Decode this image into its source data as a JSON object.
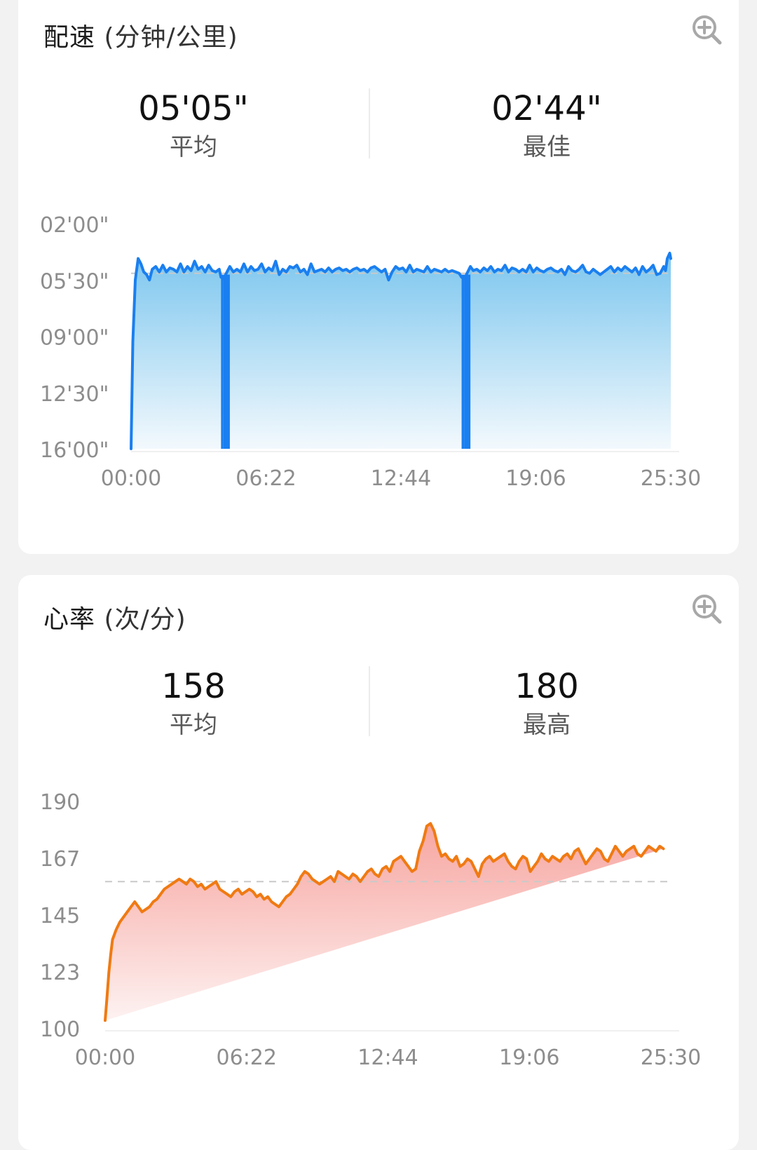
{
  "pace": {
    "title": "配速",
    "unit": "(分钟/公里)",
    "zoom_icon": "zoom-in-icon",
    "avg_value": "05'05\"",
    "avg_label": "平均",
    "best_value": "02'44\"",
    "best_label": "最佳",
    "colors": {
      "line": "#1a7ff0",
      "fill_top": "#7cc6ee",
      "fill_bottom": "#f3f9fd",
      "avg_line": "#c9c9c9"
    },
    "chart_data": {
      "type": "area",
      "title": "配速 (分钟/公里)",
      "xlabel": "",
      "ylabel": "",
      "x_ticks": [
        "00:00",
        "06:22",
        "12:44",
        "19:06",
        "25:30"
      ],
      "y_ticks": [
        "02'00\"",
        "05'30\"",
        "09'00\"",
        "12'30\"",
        "16'00\""
      ],
      "y_axis_inverted": true,
      "ylim_sec_per_km": [
        120,
        960
      ],
      "xlim_sec": [
        0,
        1530
      ],
      "average_sec_per_km": 305,
      "best_sec_per_km": 164,
      "grid": false,
      "series": [
        {
          "x_sec": [
            0,
            5,
            12,
            20,
            28,
            36,
            44,
            52,
            60,
            70,
            80,
            90,
            100,
            110,
            120,
            130,
            140,
            150,
            160,
            170,
            180,
            190,
            200,
            210,
            220,
            230,
            240,
            250,
            255,
            262,
            280,
            290,
            300,
            310,
            320,
            330,
            340,
            350,
            360,
            370,
            380,
            390,
            400,
            410,
            420,
            430,
            440,
            450,
            460,
            470,
            480,
            490,
            500,
            510,
            520,
            530,
            540,
            550,
            560,
            570,
            580,
            590,
            600,
            610,
            620,
            630,
            640,
            650,
            660,
            670,
            680,
            690,
            700,
            710,
            720,
            730,
            740,
            750,
            760,
            770,
            780,
            790,
            800,
            810,
            820,
            830,
            840,
            850,
            860,
            870,
            880,
            890,
            900,
            910,
            920,
            930,
            937,
            945,
            962,
            970,
            980,
            990,
            1000,
            1010,
            1020,
            1030,
            1040,
            1050,
            1060,
            1070,
            1080,
            1090,
            1100,
            1110,
            1120,
            1130,
            1140,
            1150,
            1160,
            1170,
            1180,
            1190,
            1200,
            1210,
            1220,
            1230,
            1240,
            1250,
            1260,
            1270,
            1280,
            1290,
            1300,
            1310,
            1320,
            1330,
            1340,
            1350,
            1360,
            1370,
            1380,
            1390,
            1400,
            1410,
            1420,
            1430,
            1440,
            1450,
            1460,
            1470,
            1480,
            1490,
            1500,
            1510,
            1515,
            1520,
            1527,
            1530
          ],
          "pace_sec_per_km": [
            960,
            560,
            330,
            250,
            270,
            300,
            310,
            330,
            290,
            280,
            300,
            275,
            300,
            285,
            290,
            300,
            270,
            300,
            280,
            295,
            260,
            290,
            280,
            300,
            275,
            295,
            300,
            290,
            320,
            325,
            280,
            300,
            290,
            300,
            270,
            300,
            280,
            295,
            290,
            270,
            300,
            285,
            295,
            260,
            310,
            290,
            300,
            280,
            285,
            275,
            300,
            290,
            310,
            270,
            300,
            295,
            290,
            300,
            285,
            300,
            290,
            285,
            295,
            290,
            300,
            290,
            285,
            295,
            290,
            300,
            285,
            280,
            290,
            300,
            290,
            330,
            300,
            280,
            290,
            285,
            300,
            275,
            300,
            290,
            295,
            300,
            280,
            300,
            290,
            295,
            300,
            290,
            300,
            295,
            300,
            305,
            320,
            325,
            280,
            295,
            290,
            300,
            285,
            295,
            280,
            300,
            290,
            295,
            275,
            300,
            285,
            290,
            300,
            290,
            300,
            275,
            300,
            285,
            295,
            300,
            290,
            285,
            295,
            300,
            290,
            310,
            280,
            295,
            300,
            290,
            275,
            300,
            305,
            290,
            300,
            310,
            300,
            290,
            280,
            300,
            285,
            295,
            280,
            290,
            300,
            285,
            310,
            280,
            300,
            290,
            275,
            310,
            305,
            280,
            295,
            250,
            230,
            250,
            205,
            185,
            200,
            215
          ]
        }
      ],
      "dropouts_sec": [
        [
          255,
          262
        ],
        [
          262,
          280
        ],
        [
          937,
          945
        ],
        [
          945,
          962
        ]
      ]
    }
  },
  "hr": {
    "title": "心率",
    "unit": "(次/分)",
    "zoom_icon": "zoom-in-icon",
    "avg_value": "158",
    "avg_label": "平均",
    "max_value": "180",
    "max_label": "最高",
    "colors": {
      "line": "#f07a12",
      "fill_top": "#f7a5a0",
      "fill_bottom": "#fdf2f1",
      "avg_line": "#c9c9c9"
    },
    "chart_data": {
      "type": "area",
      "title": "心率 (次/分)",
      "xlabel": "",
      "ylabel": "",
      "x_ticks": [
        "00:00",
        "06:22",
        "12:44",
        "19:06",
        "25:30"
      ],
      "y_ticks": [
        "190",
        "167",
        "145",
        "123",
        "100"
      ],
      "ylim": [
        100,
        190
      ],
      "xlim_sec": [
        0,
        1530
      ],
      "average_bpm": 158,
      "max_bpm": 180,
      "grid": false,
      "series": [
        {
          "x_sec": [
            0,
            5,
            10,
            15,
            20,
            30,
            40,
            50,
            60,
            70,
            80,
            90,
            100,
            110,
            120,
            130,
            140,
            150,
            160,
            170,
            180,
            190,
            200,
            210,
            220,
            230,
            240,
            250,
            260,
            270,
            280,
            290,
            300,
            310,
            320,
            330,
            340,
            350,
            360,
            370,
            380,
            390,
            400,
            410,
            420,
            430,
            440,
            450,
            460,
            470,
            480,
            490,
            500,
            510,
            520,
            530,
            540,
            550,
            560,
            570,
            580,
            590,
            600,
            610,
            620,
            630,
            640,
            650,
            660,
            670,
            680,
            690,
            700,
            710,
            720,
            730,
            740,
            750,
            760,
            770,
            780,
            790,
            800,
            810,
            820,
            830,
            840,
            850,
            860,
            870,
            880,
            890,
            900,
            910,
            920,
            930,
            940,
            950,
            960,
            970,
            980,
            990,
            1000,
            1010,
            1020,
            1030,
            1040,
            1050,
            1060,
            1070,
            1080,
            1090,
            1100,
            1110,
            1120,
            1130,
            1140,
            1150,
            1160,
            1170,
            1180,
            1190,
            1200,
            1210,
            1220,
            1230,
            1240,
            1250,
            1260,
            1270,
            1280,
            1290,
            1300,
            1310,
            1320,
            1330,
            1340,
            1350,
            1360,
            1370,
            1380,
            1390,
            1400,
            1410,
            1420,
            1430,
            1440,
            1450,
            1460,
            1470,
            1480,
            1490,
            1500,
            1510,
            1520,
            1530
          ],
          "bpm": [
            103,
            112,
            122,
            129,
            135,
            139,
            142,
            144,
            146,
            148,
            150,
            148,
            146,
            147,
            148,
            150,
            151,
            153,
            155,
            156,
            157,
            158,
            159,
            158,
            157,
            159,
            158,
            156,
            157,
            155,
            156,
            157,
            158,
            155,
            154,
            153,
            152,
            154,
            155,
            153,
            154,
            155,
            154,
            152,
            153,
            151,
            152,
            150,
            149,
            148,
            150,
            152,
            153,
            155,
            157,
            160,
            162,
            161,
            159,
            158,
            157,
            158,
            159,
            160,
            158,
            162,
            161,
            160,
            159,
            161,
            160,
            158,
            160,
            162,
            163,
            161,
            160,
            163,
            164,
            162,
            166,
            167,
            168,
            166,
            164,
            162,
            163,
            170,
            174,
            180,
            181,
            178,
            172,
            168,
            169,
            167,
            166,
            168,
            164,
            165,
            167,
            166,
            163,
            160,
            165,
            167,
            168,
            166,
            167,
            168,
            169,
            166,
            164,
            163,
            166,
            168,
            167,
            162,
            164,
            166,
            169,
            167,
            166,
            168,
            167,
            166,
            168,
            169,
            167,
            170,
            171,
            168,
            165,
            167,
            169,
            171,
            170,
            167,
            166,
            169,
            172,
            170,
            168,
            170,
            171,
            172,
            169,
            168,
            170,
            172,
            171,
            170,
            172,
            171
          ]
        }
      ]
    }
  }
}
